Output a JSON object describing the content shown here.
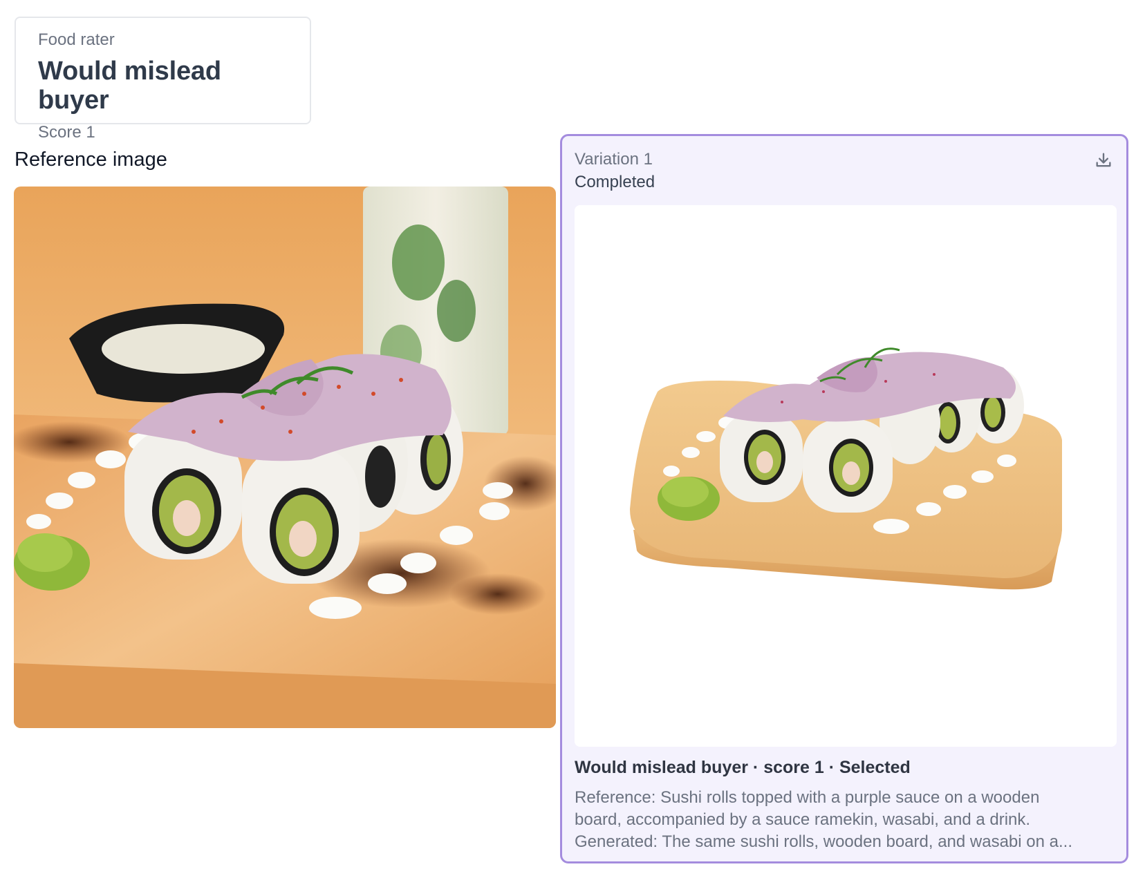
{
  "rater": {
    "kicker": "Food rater",
    "title": "Would mislead buyer",
    "score": "Score 1"
  },
  "reference": {
    "heading": "Reference image",
    "image_icon": "sushi-photo"
  },
  "variation": {
    "label": "Variation 1",
    "status": "Completed",
    "download_icon": "download-icon",
    "summary": "Would mislead buyer · score 1 · Selected",
    "description_line1": "Reference: Sushi rolls topped with a purple sauce on a wooden",
    "description_line2": "board, accompanied by a sauce ramekin, wasabi, and a drink.",
    "description_line3": "Generated: The same sushi rolls, wooden board, and wasabi on a..."
  },
  "colors": {
    "card_border": "#a48cde",
    "card_bg": "#f4f2fd",
    "title_text": "#2f3a4a",
    "muted_text": "#6b7280"
  }
}
